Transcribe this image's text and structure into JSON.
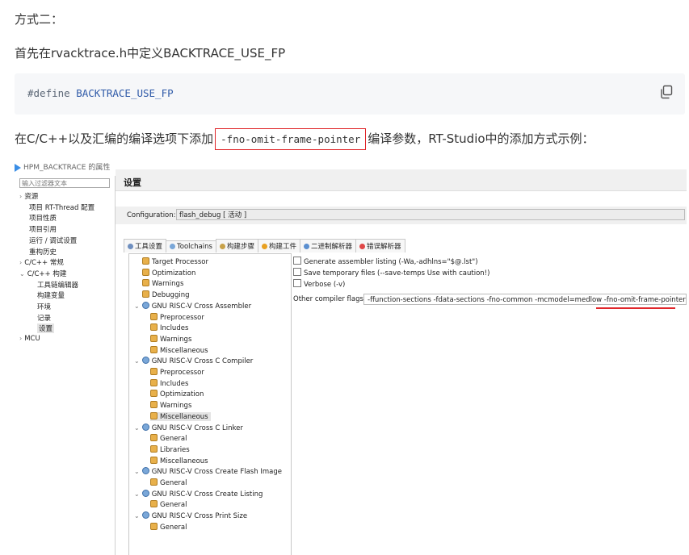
{
  "doc": {
    "heading": "方式二：",
    "line1": "首先在rvacktrace.h中定义BACKTRACE_USE_FP",
    "code_keyword": "#define",
    "code_ident": "BACKTRACE_USE_FP",
    "line2_before": "在C/C++以及汇编的编译选项下添加",
    "inline_code": "-fno-omit-frame-pointer",
    "line2_after": "编译参数，RT-Studio中的添加方式示例："
  },
  "screenshot": {
    "window_title": "HPM_BACKTRACE 的属性",
    "filter_placeholder": "输入过滤器文本",
    "left_tree": [
      {
        "label": "资源",
        "chev": "›"
      },
      {
        "label": "项目 RT-Thread 配置",
        "chev": ""
      },
      {
        "label": "项目性质",
        "chev": ""
      },
      {
        "label": "项目引用",
        "chev": ""
      },
      {
        "label": "运行 / 调试设置",
        "chev": ""
      },
      {
        "label": "重构历史",
        "chev": ""
      },
      {
        "label": "C/C++ 常规",
        "chev": "›"
      },
      {
        "label": "C/C++ 构建",
        "chev": "⌄"
      },
      {
        "label": "工具链编辑器",
        "chev": ""
      },
      {
        "label": "构建变量",
        "chev": ""
      },
      {
        "label": "环境",
        "chev": ""
      },
      {
        "label": "记录",
        "chev": ""
      },
      {
        "label": "设置",
        "chev": ""
      },
      {
        "label": "MCU",
        "chev": "›"
      }
    ],
    "panel_title": "设置",
    "config_label": "Configuration:",
    "config_value": "flash_debug  [ 活动 ]",
    "tabs": [
      "工具设置",
      "Toolchains",
      "构建步骤",
      "构建工件",
      "二进制解析器",
      "错误解析器"
    ],
    "tool_tree": [
      "Target Processor",
      "Optimization",
      "Warnings",
      "Debugging",
      "GNU RISC-V Cross Assembler",
      "Preprocessor",
      "Includes",
      "Warnings",
      "Miscellaneous",
      "GNU RISC-V Cross C Compiler",
      "Preprocessor",
      "Includes",
      "Optimization",
      "Warnings",
      "Miscellaneous",
      "GNU RISC-V Cross C Linker",
      "General",
      "Libraries",
      "Miscellaneous",
      "GNU RISC-V Cross Create Flash Image",
      "General",
      "GNU RISC-V Cross Create Listing",
      "General",
      "GNU RISC-V Cross Print Size",
      "General"
    ],
    "options": {
      "opt1": "Generate assembler listing (-Wa,-adhlns=\"$@.lst\")",
      "opt2": "Save temporary files (--save-temps Use with caution!)",
      "opt3": "Verbose (-v)",
      "flags_label": "Other compiler flags",
      "flags_value": "-ffunction-sections -fdata-sections -fno-common  -mcmodel=medlow  -fno-omit-frame-pointer"
    }
  }
}
